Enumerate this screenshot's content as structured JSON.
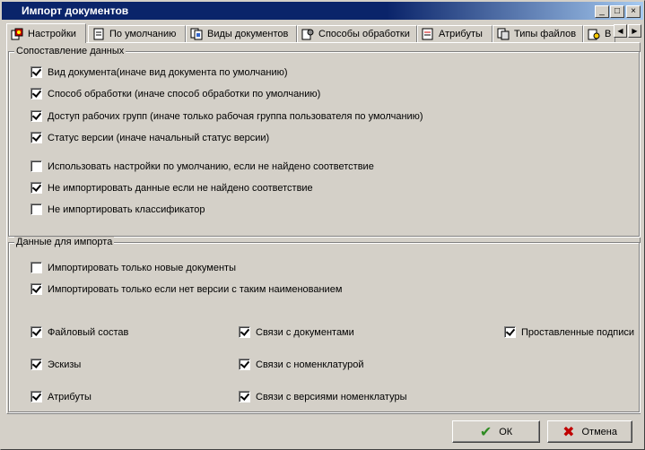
{
  "window": {
    "title": "Импорт документов"
  },
  "title_buttons": {
    "minimize": "_",
    "maximize": "□",
    "close": "×"
  },
  "tabs": [
    {
      "label": "Настройки",
      "icon": "settings-icon"
    },
    {
      "label": "По умолчанию",
      "icon": "document-icon"
    },
    {
      "label": "Виды документов",
      "icon": "documents-icon"
    },
    {
      "label": "Способы обработки",
      "icon": "processing-icon"
    },
    {
      "label": "Атрибуты",
      "icon": "attributes-icon"
    },
    {
      "label": "Типы файлов",
      "icon": "file-types-icon"
    },
    {
      "label": "В",
      "icon": "versions-icon"
    }
  ],
  "tab_scroll": {
    "left": "◀",
    "right": "▶"
  },
  "group_mapping": {
    "title": "Сопоставление данных",
    "items": [
      {
        "label": "Вид документа(иначе вид документа по умолчанию)",
        "checked": true
      },
      {
        "label": "Способ обработки (иначе способ обработки по умолчанию)",
        "checked": true
      },
      {
        "label": "Доступ рабочих групп (иначе только рабочая группа пользователя по умолчанию)",
        "checked": true
      },
      {
        "label": "Статус версии (иначе начальный статус версии)",
        "checked": true
      },
      {
        "label": "Использовать настройки по умолчанию, если не найдено соответствие",
        "checked": false
      },
      {
        "label": "Не импортировать данные если не найдено соответствие",
        "checked": true
      },
      {
        "label": "Не импортировать классификатор",
        "checked": false
      }
    ]
  },
  "group_import": {
    "title": "Данные для импорта",
    "items": [
      {
        "label": "Импортировать только новые документы",
        "checked": false
      },
      {
        "label": "Импортировать только если нет версии с таким наименованием",
        "checked": true
      },
      {
        "label": "Файловый состав",
        "checked": true
      },
      {
        "label": "Связи с документами",
        "checked": true
      },
      {
        "label": "Проставленные подписи",
        "checked": true
      },
      {
        "label": "Эскизы",
        "checked": true
      },
      {
        "label": "Связи с номенклатурой",
        "checked": true
      },
      {
        "label": "Атрибуты",
        "checked": true
      },
      {
        "label": "Связи с версиями номенклатуры",
        "checked": true
      }
    ]
  },
  "buttons": {
    "ok": {
      "label": "ОК",
      "icon": "check-icon",
      "glyph": "✔",
      "color": "#2e8b22"
    },
    "cancel": {
      "label": "Отмена",
      "icon": "cross-icon",
      "glyph": "✖",
      "color": "#c00000"
    }
  }
}
